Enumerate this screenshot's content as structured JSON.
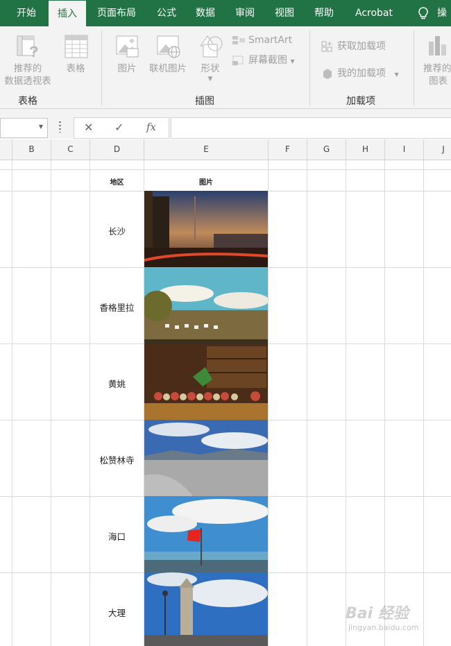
{
  "menu": {
    "tabs": [
      "开始",
      "插入",
      "页面布局",
      "公式",
      "数据",
      "审阅",
      "视图",
      "帮助",
      "Acrobat"
    ],
    "active_tab": "插入",
    "tell_me_partial": "操"
  },
  "ribbon": {
    "groups": {
      "tables": "表格",
      "illustrations": "插图",
      "addins": "加载项"
    },
    "buttons": {
      "recommended_pivot_line1": "推荐的",
      "recommended_pivot_line2": "数据透视表",
      "table": "表格",
      "pictures": "图片",
      "online_pictures": "联机图片",
      "shapes": "形状",
      "smartart": "SmartArt",
      "screenshot": "屏幕截图",
      "get_addins": "获取加载项",
      "my_addins": "我的加载项",
      "recommended_charts_line1": "推荐的",
      "recommended_charts_line2": "图表"
    }
  },
  "formula_bar": {
    "cancel_symbol": "✕",
    "enter_symbol": "✓",
    "fx_label": "fx",
    "value": ""
  },
  "columns": [
    "B",
    "C",
    "D",
    "E",
    "F",
    "G",
    "H",
    "I",
    "J"
  ],
  "sheet": {
    "header": {
      "region": "地区",
      "image": "图片"
    },
    "rows": [
      {
        "region": "长沙",
        "photo": "city-night-skyline"
      },
      {
        "region": "香格里拉",
        "photo": "grassland-sheep-clouds"
      },
      {
        "region": "黄姚",
        "photo": "shop-shelf-pottery"
      },
      {
        "region": "松赞林寺",
        "photo": "frosty-plain-clouds"
      },
      {
        "region": "海口",
        "photo": "flag-seaside-clouds"
      },
      {
        "region": "大理",
        "photo": "street-lamp-gate"
      }
    ]
  },
  "watermark": {
    "brand": "Bai 经验",
    "url": "jingyan.baidu.com"
  }
}
